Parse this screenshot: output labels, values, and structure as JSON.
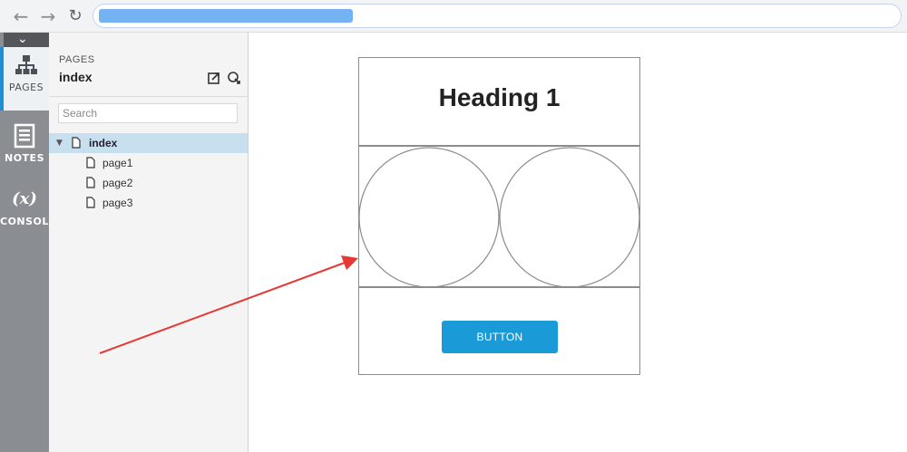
{
  "browser": {
    "back_icon": "back-arrow-icon",
    "forward_icon": "forward-arrow-icon",
    "reload_icon": "reload-icon",
    "url_blurred_color": "#5aa6f2"
  },
  "rail": {
    "collapse_icon": "chevron-down-icon",
    "tabs": [
      {
        "label": "PAGES",
        "icon": "sitemap-icon",
        "active": true
      },
      {
        "label": "NOTES",
        "icon": "notes-icon",
        "active": false
      },
      {
        "label": "CONSOLE",
        "icon": "variable-icon",
        "symbol": "(x)",
        "active": false
      }
    ],
    "accent_color": "#1e8fd5"
  },
  "pages_panel": {
    "header": "PAGES",
    "current_page": "index",
    "search_placeholder": "Search",
    "tree": [
      {
        "label": "index",
        "selected": true,
        "expanded": true
      },
      {
        "label": "page1"
      },
      {
        "label": "page2"
      },
      {
        "label": "page3"
      }
    ]
  },
  "canvas": {
    "heading": "Heading 1",
    "button_label": "BUTTON",
    "button_color": "#1a9bd8",
    "annotation_color": "#e53935"
  }
}
